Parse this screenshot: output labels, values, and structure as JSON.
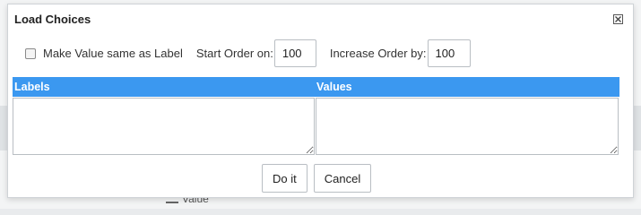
{
  "background": {
    "partial_text": "Value"
  },
  "dialog": {
    "title": "Load Choices",
    "close_icon": "close-icon"
  },
  "options": {
    "make_value_same_label": "Make Value same as Label",
    "make_value_same_checked": false,
    "start_order_label": "Start Order on:",
    "start_order_value": "100",
    "increase_order_label": "Increase Order by:",
    "increase_order_value": "100"
  },
  "table": {
    "header_color": "#3b98f0",
    "columns": [
      "Labels",
      "Values"
    ],
    "labels_value": "",
    "values_value": ""
  },
  "actions": {
    "do_it_label": "Do it",
    "cancel_label": "Cancel"
  }
}
